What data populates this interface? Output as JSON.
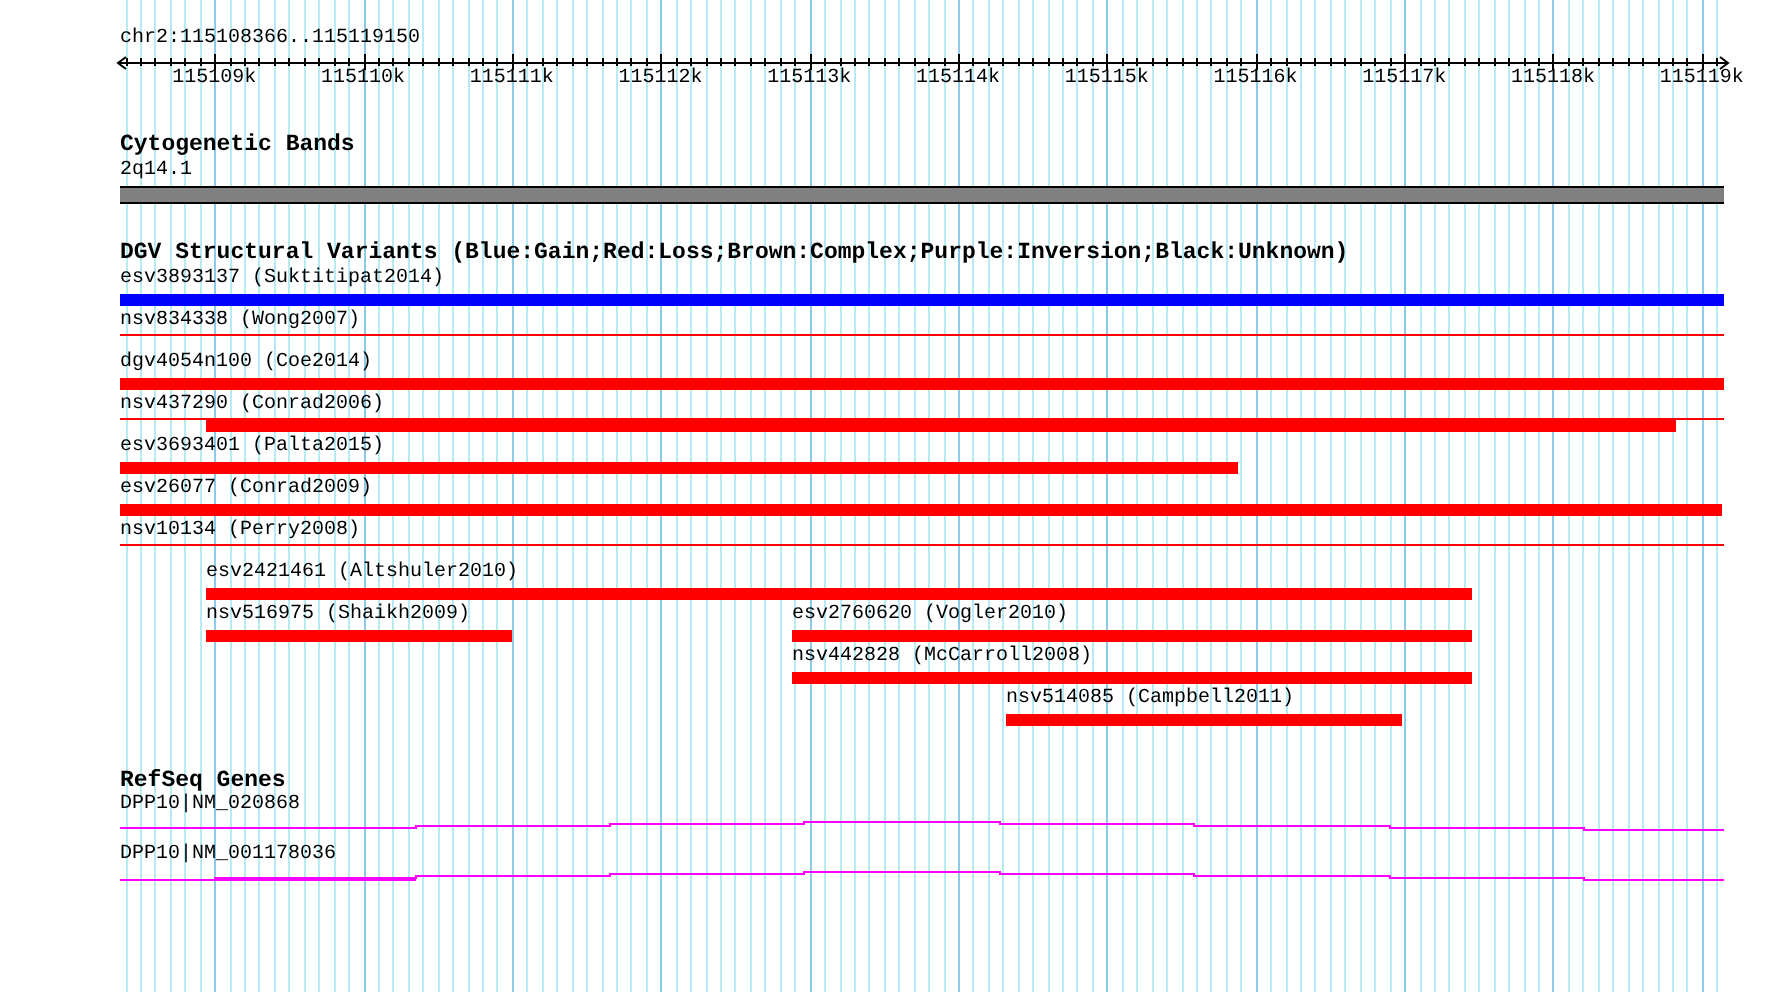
{
  "ruler": {
    "region": "chr2:115108366..115119150",
    "ticks": [
      "115109k",
      "115110k",
      "115111k",
      "115112k",
      "115113k",
      "115114k",
      "115115k",
      "115116k",
      "115117k",
      "115118k",
      "115119k"
    ]
  },
  "tracks": [
    {
      "kind": "bands",
      "title": "Cytogenetic Bands",
      "features": [
        {
          "label": "2q14.1"
        }
      ]
    },
    {
      "kind": "variants",
      "title": "DGV Structural Variants (Blue:Gain;Red:Loss;Brown:Complex;Purple:Inversion;Black:Unknown)",
      "features": [
        {
          "label": "esv3893137 (Suktitipat2014)",
          "color": "#0000ff"
        },
        {
          "label": "nsv834338 (Wong2007)",
          "color": "#ff0000"
        },
        {
          "label": "dgv4054n100 (Coe2014)",
          "color": "#ff0000"
        },
        {
          "label": "nsv437290 (Conrad2006)",
          "color": "#ff0000"
        },
        {
          "label": "esv3693401 (Palta2015)",
          "color": "#ff0000"
        },
        {
          "label": "esv26077 (Conrad2009)",
          "color": "#ff0000"
        },
        {
          "label": "nsv10134 (Perry2008)",
          "color": "#ff0000"
        },
        {
          "label": "esv2421461 (Altshuler2010)",
          "color": "#ff0000"
        },
        {
          "label": "nsv516975 (Shaikh2009)",
          "color": "#ff0000"
        },
        {
          "label": "esv2760620 (Vogler2010)",
          "color": "#ff0000"
        },
        {
          "label": "nsv442828 (McCarroll2008)",
          "color": "#ff0000"
        },
        {
          "label": "nsv514085 (Campbell2011)",
          "color": "#ff0000"
        }
      ]
    },
    {
      "kind": "genes",
      "title": "RefSeq Genes",
      "features": [
        {
          "label": "DPP10|NM_020868"
        },
        {
          "label": "DPP10|NM_001178036"
        }
      ]
    }
  ]
}
